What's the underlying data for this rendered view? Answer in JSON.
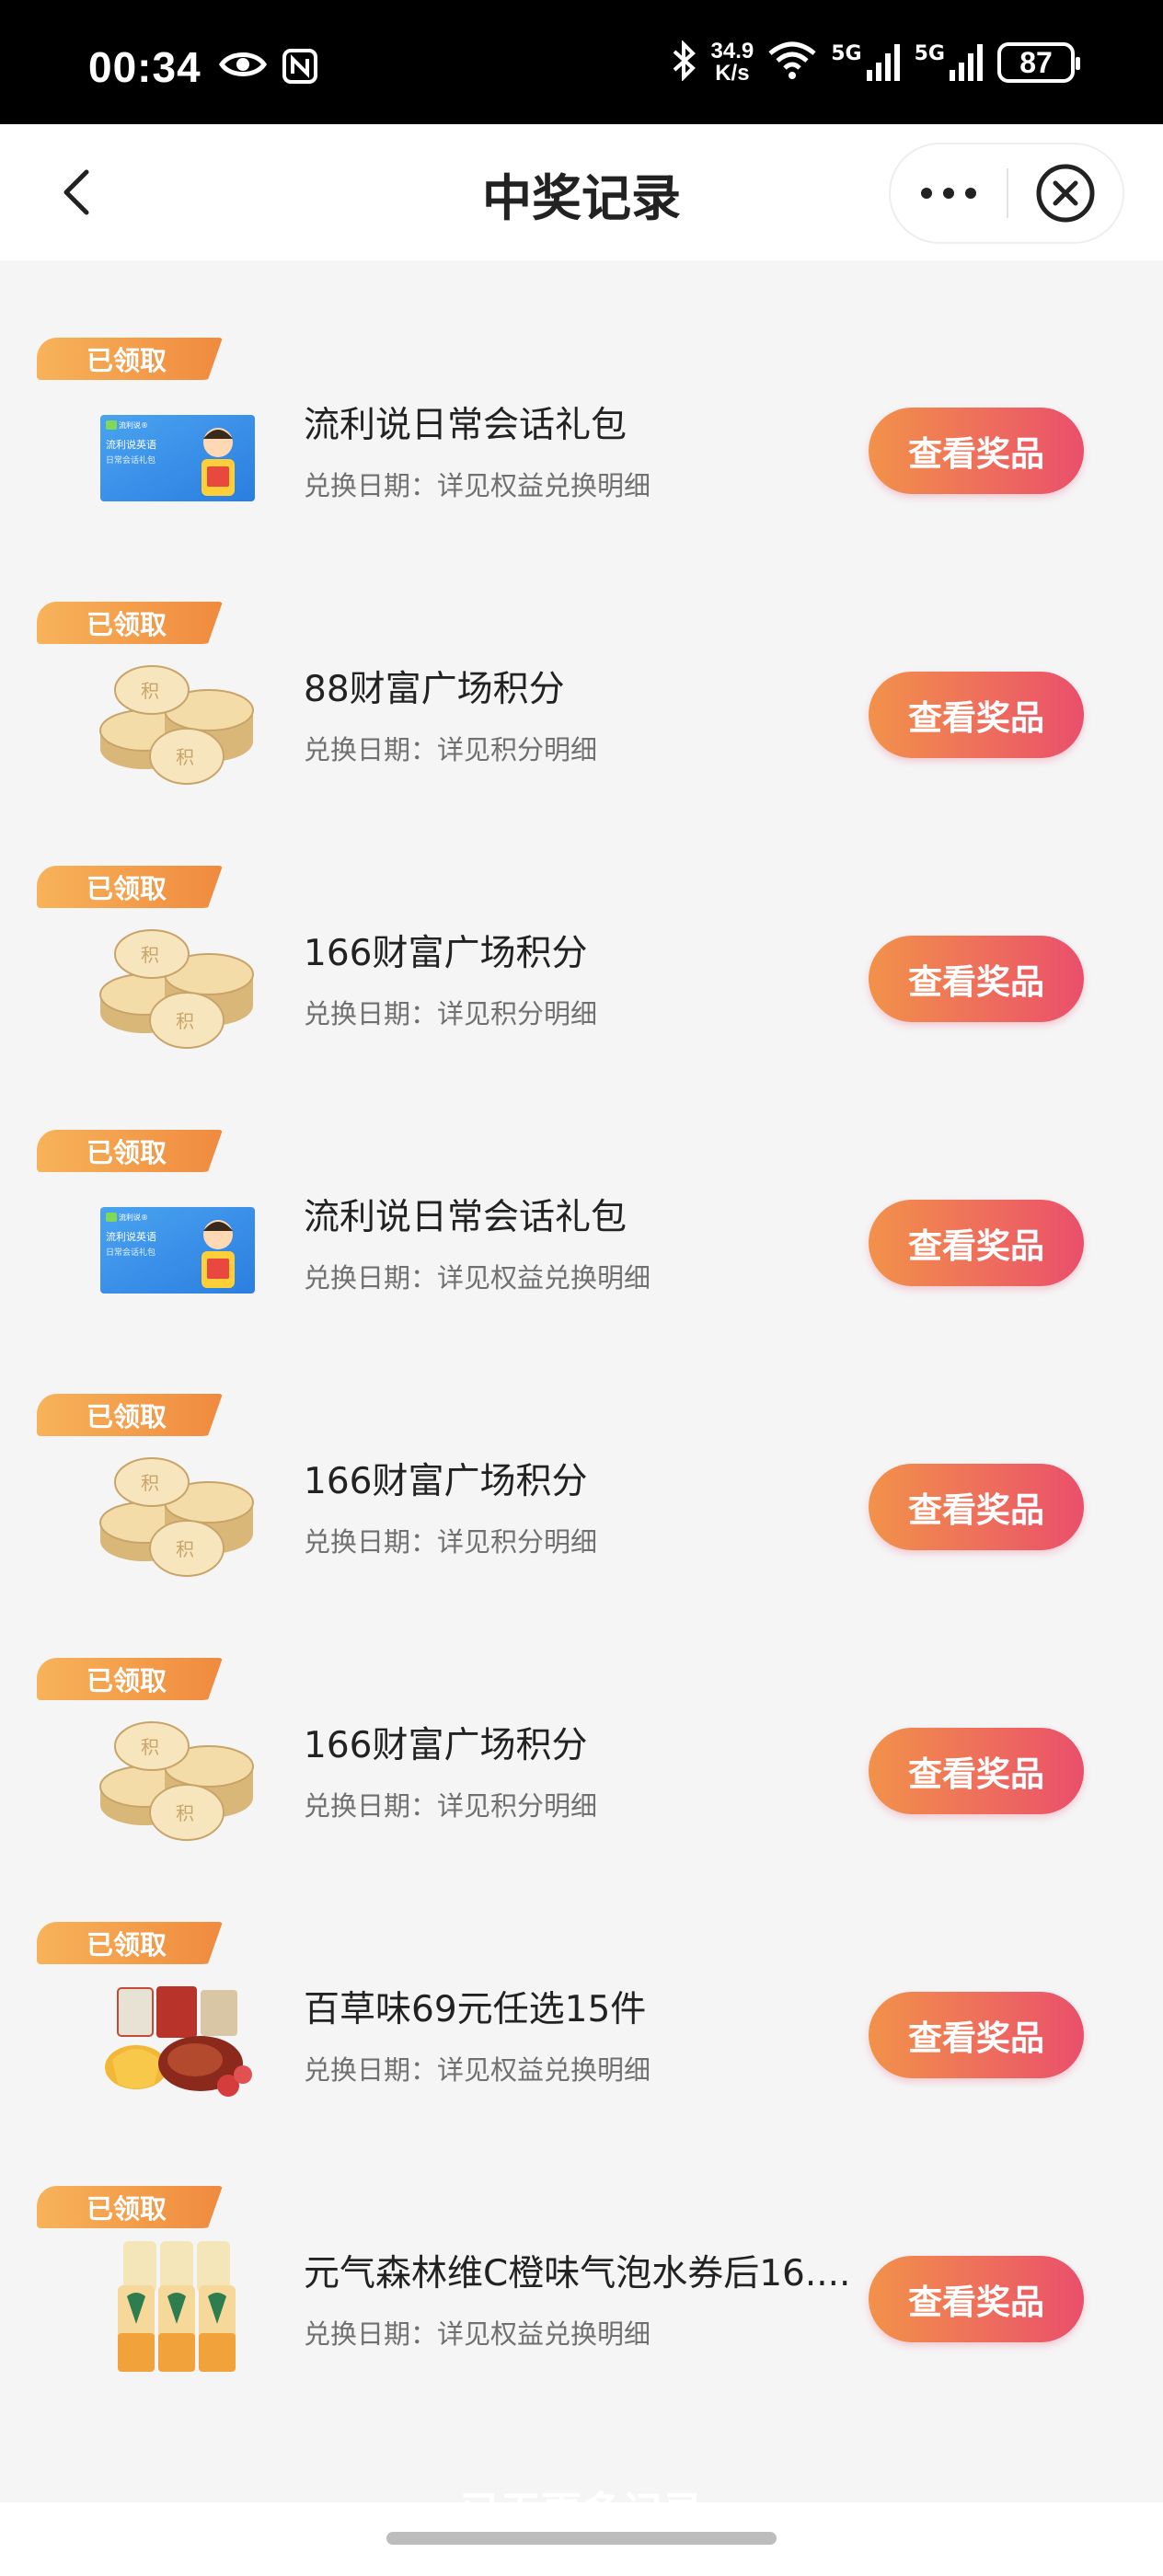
{
  "status_bar": {
    "time": "00:34",
    "speed_value": "34.9",
    "speed_unit": "K/s",
    "net1": "5G",
    "net2": "5G",
    "battery": "87"
  },
  "header": {
    "title": "中奖记录"
  },
  "tag_label": "已领取",
  "view_label": "查看奖品",
  "items": [
    {
      "title": "流利说日常会话礼包",
      "date": "兑换日期：详见权益兑换明细",
      "thumb": "course-card-icon"
    },
    {
      "title": "88财富广场积分",
      "date": "兑换日期：详见积分明细",
      "thumb": "coins-icon"
    },
    {
      "title": "166财富广场积分",
      "date": "兑换日期：详见积分明细",
      "thumb": "coins-icon"
    },
    {
      "title": "流利说日常会话礼包",
      "date": "兑换日期：详见权益兑换明细",
      "thumb": "course-card-icon"
    },
    {
      "title": "166财富广场积分",
      "date": "兑换日期：详见积分明细",
      "thumb": "coins-icon"
    },
    {
      "title": "166财富广场积分",
      "date": "兑换日期：详见积分明细",
      "thumb": "coins-icon"
    },
    {
      "title": "百草味69元任选15件",
      "date": "兑换日期：详见权益兑换明细",
      "thumb": "snacks-icon"
    },
    {
      "title": "元气森林维C橙味气泡水券后16....",
      "date": "兑换日期：详见权益兑换明细",
      "thumb": "drink-cans-icon"
    }
  ],
  "card_texts": {
    "brand": "流利说®",
    "line1": "流利说英语",
    "line2": "日常会话礼包"
  },
  "coin_char": "积",
  "footer_hint": "已无更多记录",
  "colors": {
    "tag_start": "#f7b35a",
    "tag_end": "#f08a3e",
    "button_start": "#f2924a",
    "button_end": "#ea4f6b"
  }
}
